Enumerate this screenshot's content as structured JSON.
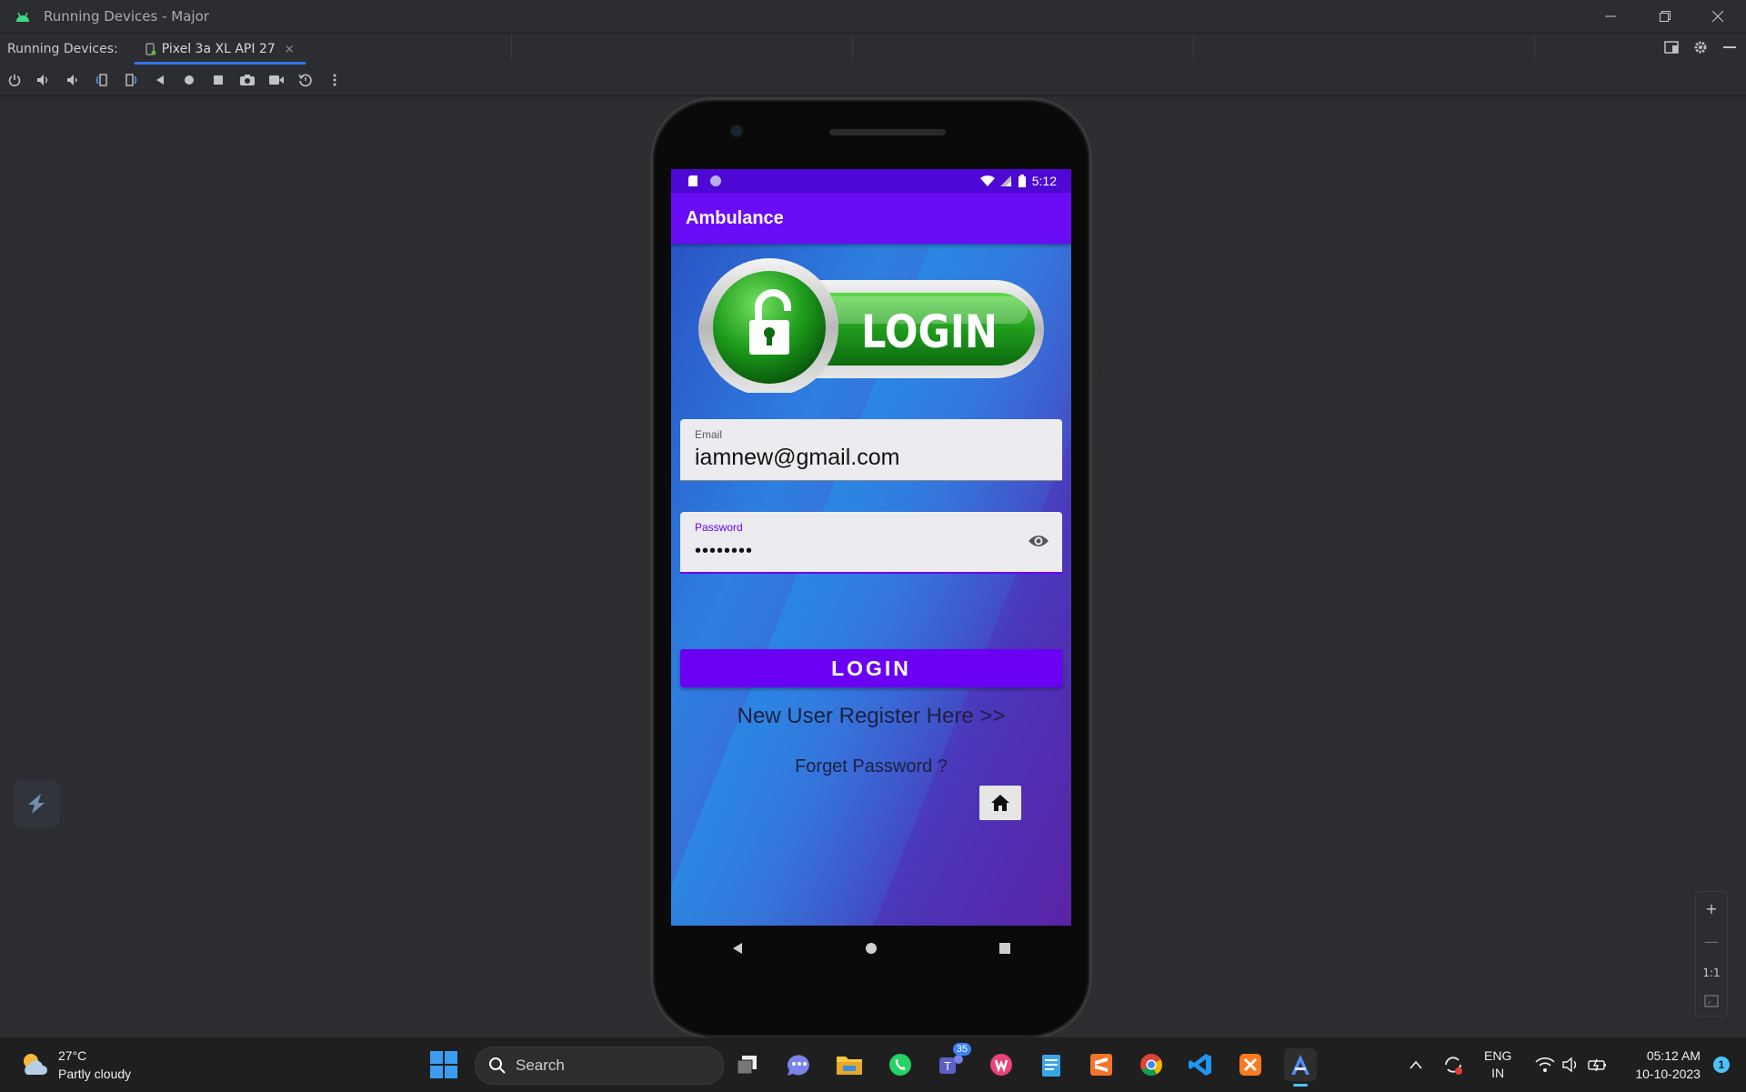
{
  "window": {
    "title": "Running Devices - Major",
    "controls": [
      "minimize",
      "restore",
      "close"
    ]
  },
  "tabbar": {
    "label": "Running Devices:",
    "active_tab": "Pixel 3a XL API 27",
    "close_glyph": "×"
  },
  "toolbar": {
    "icons": [
      "power-icon",
      "volume-up-icon",
      "volume-down-icon",
      "rotate-left-icon",
      "rotate-right-icon",
      "back-icon",
      "home-icon",
      "overview-icon",
      "screenshot-icon",
      "screen-record-icon",
      "reset-icon",
      "more-icon"
    ]
  },
  "device": {
    "status_time": "5:12",
    "app_title": "Ambulance",
    "logo_text": "LOGIN",
    "email": {
      "label": "Email",
      "value": "iamnew@gmail.com"
    },
    "password": {
      "label": "Password",
      "value": "••••••••"
    },
    "login_button": "LOGIN",
    "register_link": "New User Register Here >>",
    "forgot_link": "Forget Password ?",
    "colors": {
      "statusbar": "#4e08d6",
      "appbar": "#6a0cf5",
      "button": "#6a00f4",
      "focus": "#6a00f4"
    }
  },
  "zoom_controls": {
    "zoom_in": "+",
    "zoom_out": "—",
    "actual_size": "1:1"
  },
  "taskbar": {
    "weather_temp": "27°C",
    "weather_desc": "Partly cloudy",
    "search_placeholder": "Search",
    "teams_badge": "35",
    "language_line1": "ENG",
    "language_line2": "IN",
    "time": "05:12 AM",
    "date": "10-10-2023",
    "notification_count": "1"
  }
}
